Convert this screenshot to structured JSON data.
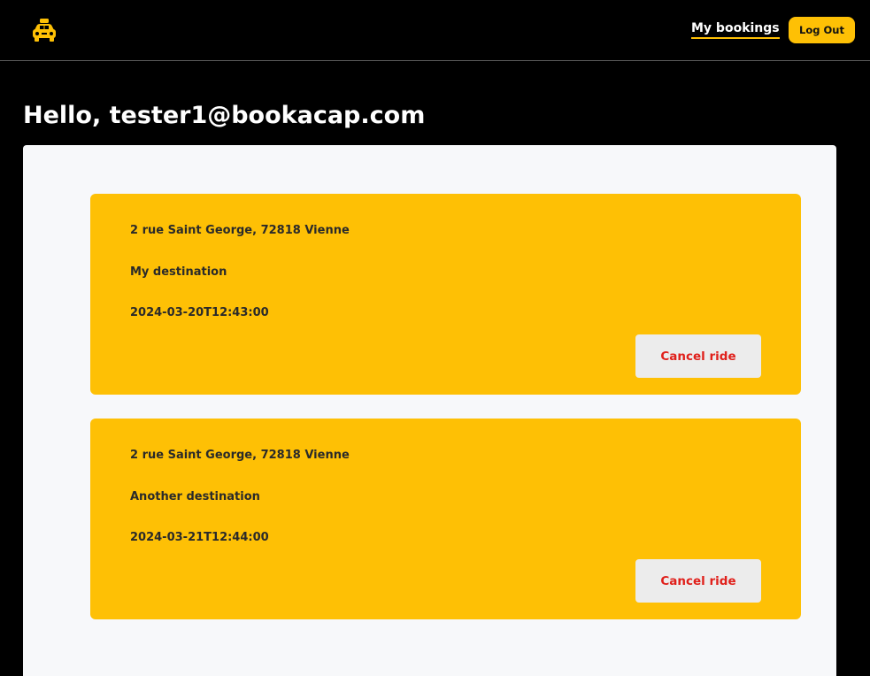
{
  "header": {
    "logo_icon": "taxi-icon",
    "nav_link_label": "My bookings",
    "logout_label": "Log Out"
  },
  "colors": {
    "brand_yellow": "#fec005",
    "cancel_red": "#e0201b",
    "background": "#000000",
    "panel": "#f7f8fa"
  },
  "greeting": "Hello, tester1@bookacap.com",
  "bookings": [
    {
      "pickup": "2 rue Saint George, 72818 Vienne",
      "destination": "My destination",
      "datetime": "2024-03-20T12:43:00",
      "cancel_label": "Cancel ride"
    },
    {
      "pickup": "2 rue Saint George, 72818 Vienne",
      "destination": "Another destination",
      "datetime": "2024-03-21T12:44:00",
      "cancel_label": "Cancel ride"
    }
  ]
}
